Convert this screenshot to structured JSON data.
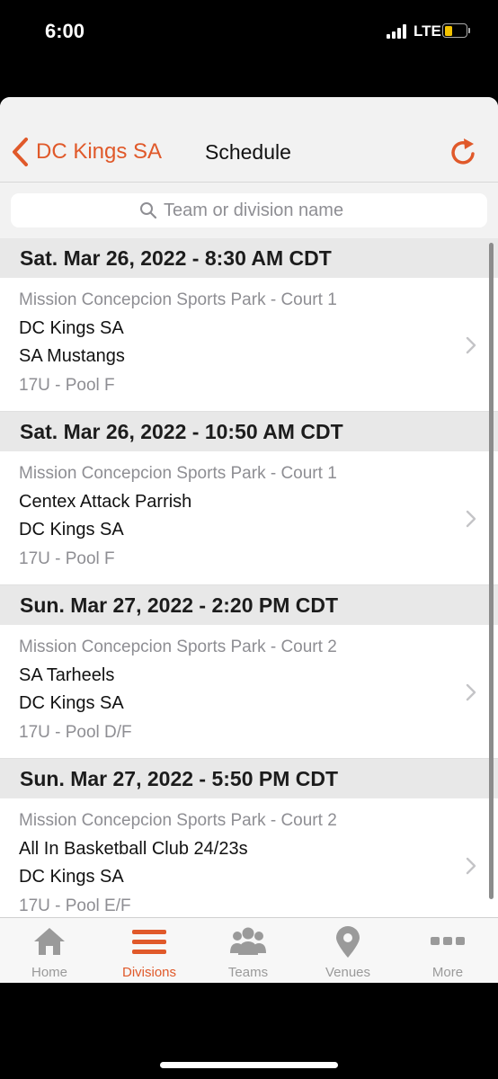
{
  "status": {
    "time": "6:00",
    "network": "LTE"
  },
  "nav": {
    "back_label": "DC Kings SA",
    "title": "Schedule"
  },
  "search": {
    "placeholder": "Team or division name"
  },
  "games": [
    {
      "date": "Sat. Mar 26, 2022 - 8:30 AM CDT",
      "venue": "Mission Concepcion Sports Park - Court 1",
      "team1": "DC Kings SA",
      "team2": "SA Mustangs",
      "division": "17U - Pool F"
    },
    {
      "date": "Sat. Mar 26, 2022 - 10:50 AM CDT",
      "venue": "Mission Concepcion Sports Park - Court 1",
      "team1": "Centex Attack Parrish",
      "team2": "DC Kings SA",
      "division": "17U - Pool F"
    },
    {
      "date": "Sun. Mar 27, 2022 - 2:20 PM CDT",
      "venue": "Mission Concepcion Sports Park - Court 2",
      "team1": "SA Tarheels",
      "team2": "DC Kings SA",
      "division": "17U - Pool D/F"
    },
    {
      "date": "Sun. Mar 27, 2022 - 5:50 PM CDT",
      "venue": "Mission Concepcion Sports Park - Court 2",
      "team1": "All In Basketball Club 24/23s",
      "team2": "DC Kings SA",
      "division": "17U - Pool E/F"
    }
  ],
  "tabs": [
    {
      "label": "Home",
      "icon": "home-icon"
    },
    {
      "label": "Divisions",
      "icon": "list-icon",
      "active": true
    },
    {
      "label": "Teams",
      "icon": "people-icon"
    },
    {
      "label": "Venues",
      "icon": "location-pin-icon"
    },
    {
      "label": "More",
      "icon": "more-dots-icon"
    }
  ],
  "colors": {
    "accent": "#e0592a",
    "inactive": "#9a9a9a",
    "section_bg": "#e8e8e8"
  }
}
